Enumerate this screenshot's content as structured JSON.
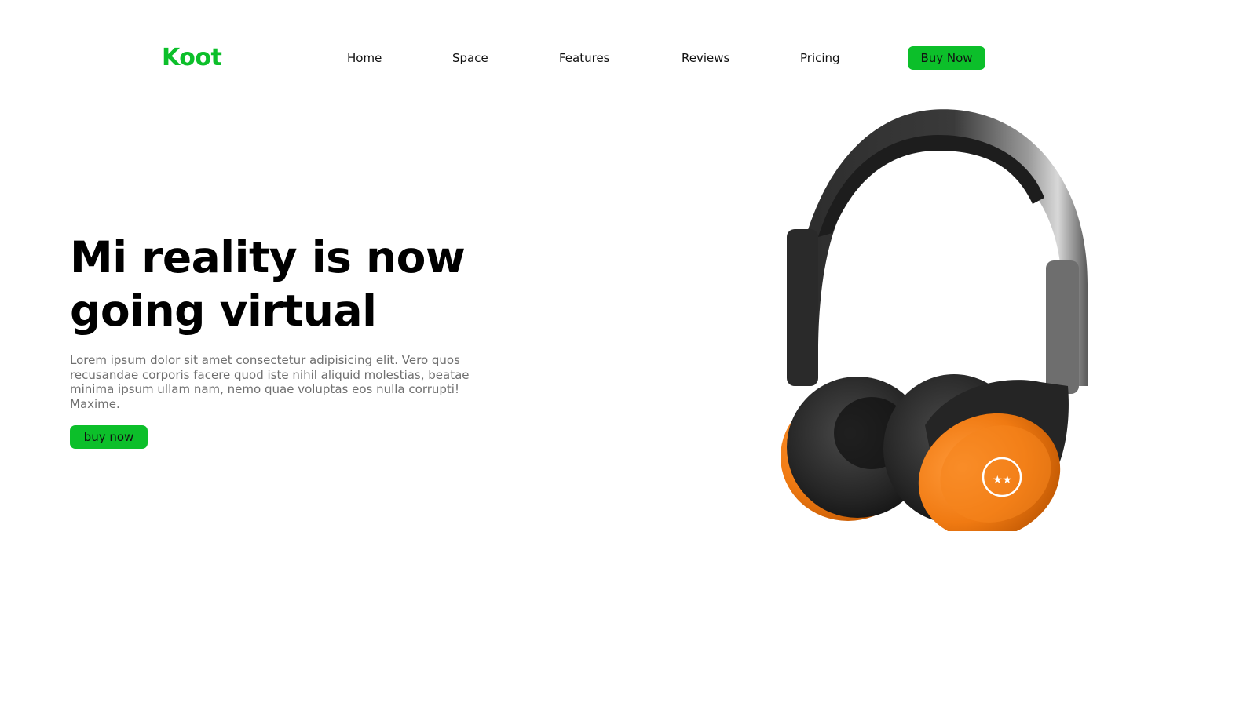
{
  "header": {
    "logo": "Koot",
    "nav": [
      {
        "label": "Home"
      },
      {
        "label": "Space"
      },
      {
        "label": "Features"
      },
      {
        "label": "Reviews"
      },
      {
        "label": "Pricing"
      }
    ],
    "cta_label": "Buy Now"
  },
  "hero": {
    "title_line1": "Mi reality is now",
    "title_line2": "going virtual",
    "text": "Lorem ipsum dolor sit amet consectetur adipisicing elit. Vero quos recusandae corporis facere quod iste nihil aliquid molestias, beatae minima ipsum ullam nam, nemo quae voluptas eos nulla corrupti! Maxime.",
    "cta_label": "buy now",
    "image_icon": "headphones-image"
  },
  "colors": {
    "accent": "#0cbf2a",
    "text": "#000000",
    "muted": "#6f6f6f",
    "headphone_accent": "#f07a12"
  }
}
